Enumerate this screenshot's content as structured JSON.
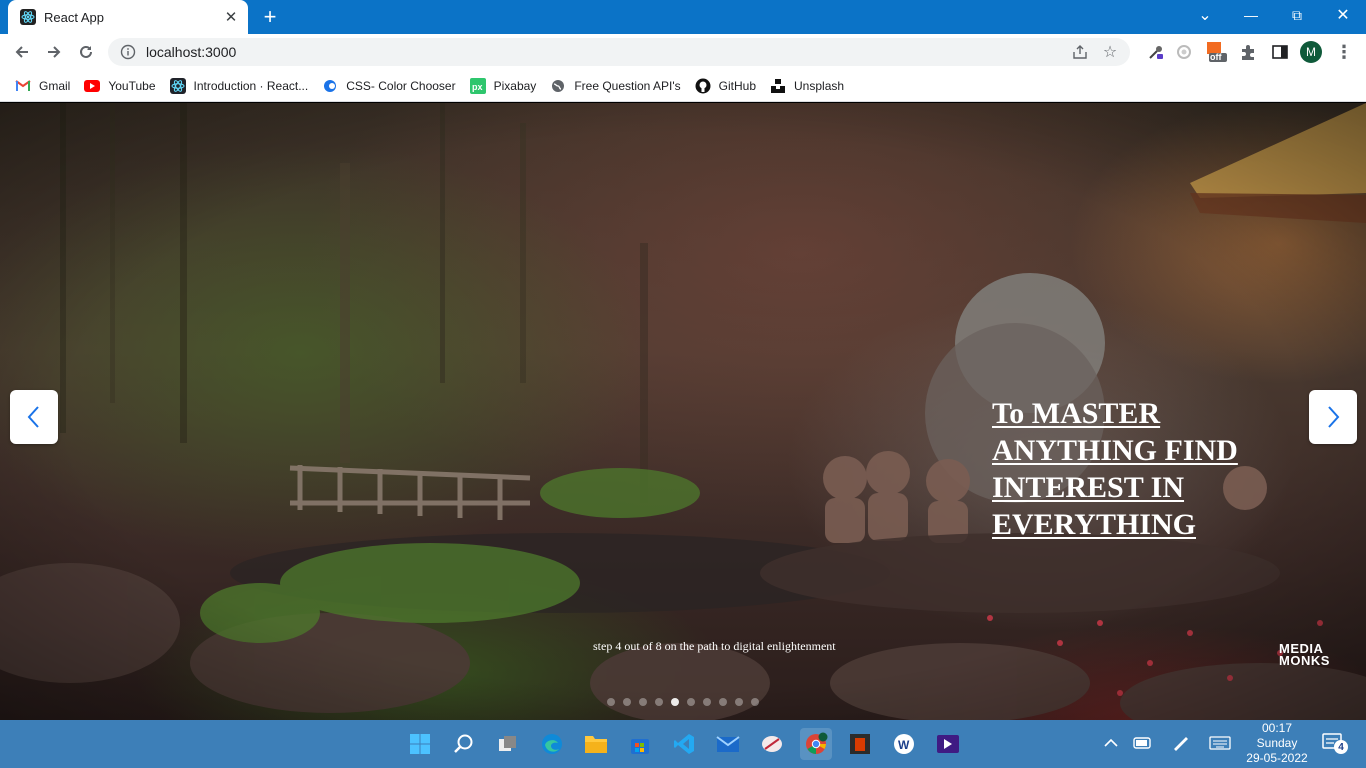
{
  "browser": {
    "tab": {
      "title": "React App",
      "close": "✕"
    },
    "new_tab": "+",
    "window": {
      "minimize": "—",
      "maximize": "⧉",
      "close": "✕",
      "tab_search": "⌄"
    },
    "url": "localhost:3000",
    "profile_initial": "M",
    "extension_badge": "off"
  },
  "bookmarks": [
    {
      "label": "Gmail",
      "icon": "gmail-icon"
    },
    {
      "label": "YouTube",
      "icon": "youtube-icon"
    },
    {
      "label": "Introduction · React...",
      "icon": "react-icon"
    },
    {
      "label": "CSS- Color Chooser",
      "icon": "color-chooser-icon"
    },
    {
      "label": "Pixabay",
      "icon": "pixabay-icon"
    },
    {
      "label": "Free Question API's",
      "icon": "globe-icon"
    },
    {
      "label": "GitHub",
      "icon": "github-icon"
    },
    {
      "label": "Unsplash",
      "icon": "unsplash-icon"
    }
  ],
  "slide": {
    "headline": "To MASTER ANYTHING FIND INTEREST IN EVERYTHING",
    "caption": "step 4 out of 8 on the path to digital enlightenment",
    "brand_line1": "MEDIA",
    "brand_line2": "MONKS",
    "indicator_count": 10,
    "active_indicator": 4
  },
  "taskbar": {
    "apps": [
      "start-icon",
      "search-icon",
      "task-view-icon",
      "edge-icon",
      "file-explorer-icon",
      "store-icon",
      "vscode-icon",
      "mail-icon",
      "snipping-tool-icon",
      "chrome-icon",
      "office-icon",
      "app-w-icon",
      "visual-studio-icon"
    ],
    "clock": {
      "time": "00:17",
      "day": "Sunday",
      "date": "29-05-2022"
    },
    "notification_count": "4"
  },
  "colors": {
    "titlebar": "#0b73c7",
    "taskbar": "#3d7fb8"
  }
}
